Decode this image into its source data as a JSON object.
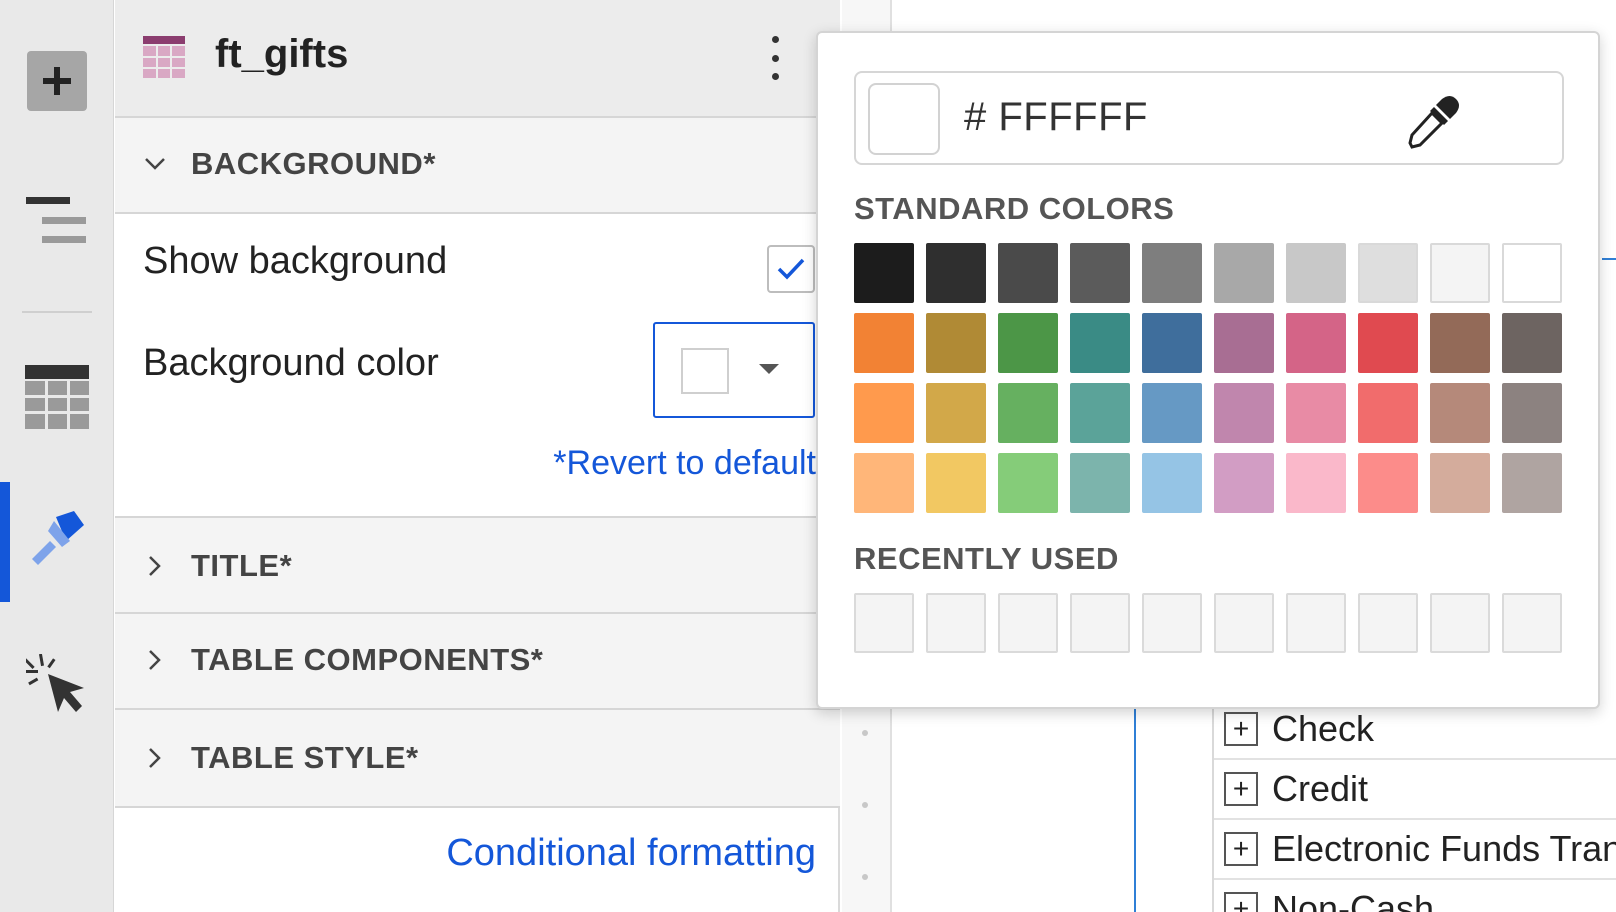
{
  "panel": {
    "title": "ft_gifts",
    "sections": {
      "background": "BACKGROUND*",
      "title": "TITLE*",
      "table_components": "TABLE COMPONENTS*",
      "table_style": "TABLE STYLE*"
    },
    "show_background": {
      "label": "Show background",
      "checked": true
    },
    "background_color": {
      "label": "Background color",
      "value": "#FFFFFF"
    },
    "revert_link": "*Revert to default",
    "conditional_link": "Conditional formatting"
  },
  "rail": {
    "icons": [
      "add-icon",
      "outline-icon",
      "table-icon",
      "format-brush-icon",
      "actions-cursor-icon"
    ],
    "active": "format-brush-icon",
    "accent": "#1457D9"
  },
  "picker": {
    "hex_prefix": "#",
    "hex_value": "FFFFFF",
    "standard_heading": "STANDARD COLORS",
    "recent_heading": "RECENTLY USED",
    "standard_colors": [
      "#1C1C1C",
      "#2F2F2F",
      "#4A4A4A",
      "#5B5B5B",
      "#7E7E7E",
      "#A8A8A8",
      "#C8C8C8",
      "#DEDEDE",
      "#F4F4F4",
      "#FFFFFF",
      "#F28234",
      "#B08A35",
      "#4C9647",
      "#3A8B85",
      "#3F6E9C",
      "#A86E93",
      "#D46487",
      "#E04A50",
      "#936A58",
      "#6D6461",
      "#FF9A4D",
      "#D2A849",
      "#66B060",
      "#5BA399",
      "#6699C4",
      "#C086AD",
      "#E88BA5",
      "#F16C6C",
      "#B5897A",
      "#8C8280",
      "#FFB679",
      "#F2C862",
      "#85CC79",
      "#7CB4AC",
      "#95C4E5",
      "#D29DC4",
      "#FAB8CA",
      "#FC8C8A",
      "#D4AC9C",
      "#AFA4A1"
    ],
    "recent_count": 10
  },
  "canvas": {
    "pivot_rows": [
      "Check",
      "Credit",
      "Electronic Funds Trans",
      "Non-Cash"
    ]
  }
}
